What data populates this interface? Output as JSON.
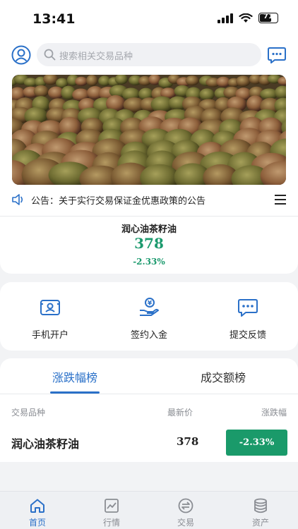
{
  "status_bar": {
    "time": "13:41",
    "battery": "71",
    "battery_level": 0.71,
    "icons": [
      "signal-icon",
      "wifi-icon",
      "battery-icon"
    ]
  },
  "header": {
    "search_placeholder": "搜索相关交易品种",
    "icons": [
      "user-avatar-icon",
      "search-icon",
      "message-icon"
    ]
  },
  "banner": {
    "image": "camellia-oil-fruit-photo"
  },
  "notice": {
    "text": "公告：关于实行交易保证金优惠政策的公告"
  },
  "featured": {
    "name": "润心油茶籽油",
    "price": "378",
    "change": "-2.33%"
  },
  "quick_actions": [
    {
      "label": "手机开户",
      "icon": "id-card-icon"
    },
    {
      "label": "签约入金",
      "icon": "hand-coin-icon"
    },
    {
      "label": "提交反馈",
      "icon": "feedback-icon"
    }
  ],
  "ranking": {
    "tabs": [
      {
        "label": "涨跌幅榜",
        "active": true
      },
      {
        "label": "成交额榜",
        "active": false
      }
    ],
    "columns": [
      "交易品种",
      "最新价",
      "涨跌幅"
    ],
    "rows": [
      {
        "name": "润心油茶籽油",
        "price": "378",
        "change": "-2.33%"
      }
    ]
  },
  "tabbar": [
    {
      "label": "首页",
      "icon": "home-icon",
      "active": true
    },
    {
      "label": "行情",
      "icon": "chart-icon",
      "active": false
    },
    {
      "label": "交易",
      "icon": "exchange-icon",
      "active": false
    },
    {
      "label": "资产",
      "icon": "database-icon",
      "active": false
    }
  ],
  "colors": {
    "accent": "#2a70c8",
    "down": "#1a9a6a",
    "background": "#f2f3f5"
  }
}
